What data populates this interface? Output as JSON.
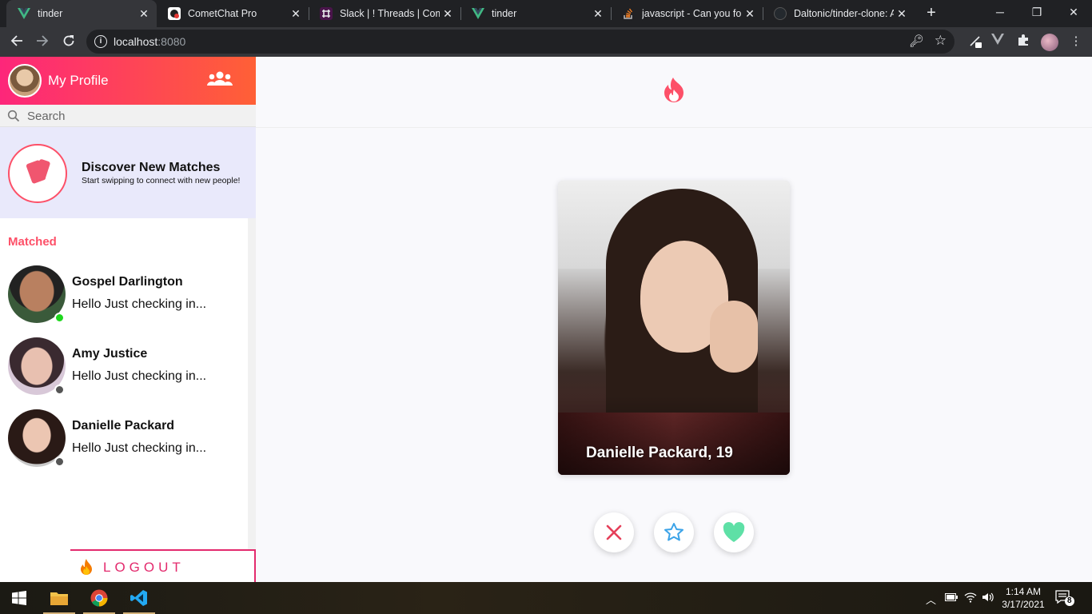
{
  "browser": {
    "tabs": [
      {
        "title": "tinder",
        "favicon": "vue-icon",
        "active": true
      },
      {
        "title": "CometChat Pro",
        "favicon": "cometchat-icon",
        "active": false
      },
      {
        "title": "Slack | ! Threads | Come",
        "favicon": "slack-icon",
        "active": false
      },
      {
        "title": "tinder",
        "favicon": "vue-icon",
        "active": false
      },
      {
        "title": "javascript - Can you for",
        "favicon": "stackoverflow-icon",
        "active": false
      },
      {
        "title": "Daltonic/tinder-clone: A",
        "favicon": "github-icon",
        "active": false
      }
    ],
    "url_host": "localhost",
    "url_port": ":8080"
  },
  "sidebar": {
    "profile_label": "My Profile",
    "search_placeholder": "Search",
    "discover_title": "Discover New Matches",
    "discover_subtitle": "Start swipping to connect with new people!",
    "matched_label": "Matched",
    "matches": [
      {
        "name": "Gospel Darlington",
        "message": "Hello Just checking in...",
        "online": true
      },
      {
        "name": "Amy Justice",
        "message": "Hello Just checking in...",
        "online": false
      },
      {
        "name": "Danielle Packard",
        "message": "Hello Just checking in...",
        "online": false
      }
    ],
    "logout_label": "LOGOUT"
  },
  "main": {
    "card_caption": "Danielle Packard, 19"
  },
  "taskbar": {
    "time": "1:14 AM",
    "date": "3/17/2021",
    "notification_count": "8"
  },
  "colors": {
    "brand_gradient_start": "#fd267a",
    "brand_gradient_end": "#ff6036",
    "accent": "#fd5068",
    "online": "#1ed71e",
    "offline": "#555555",
    "like": "#5ee0a6",
    "superlike": "#3ba3e8",
    "nope": "#e5405a"
  }
}
